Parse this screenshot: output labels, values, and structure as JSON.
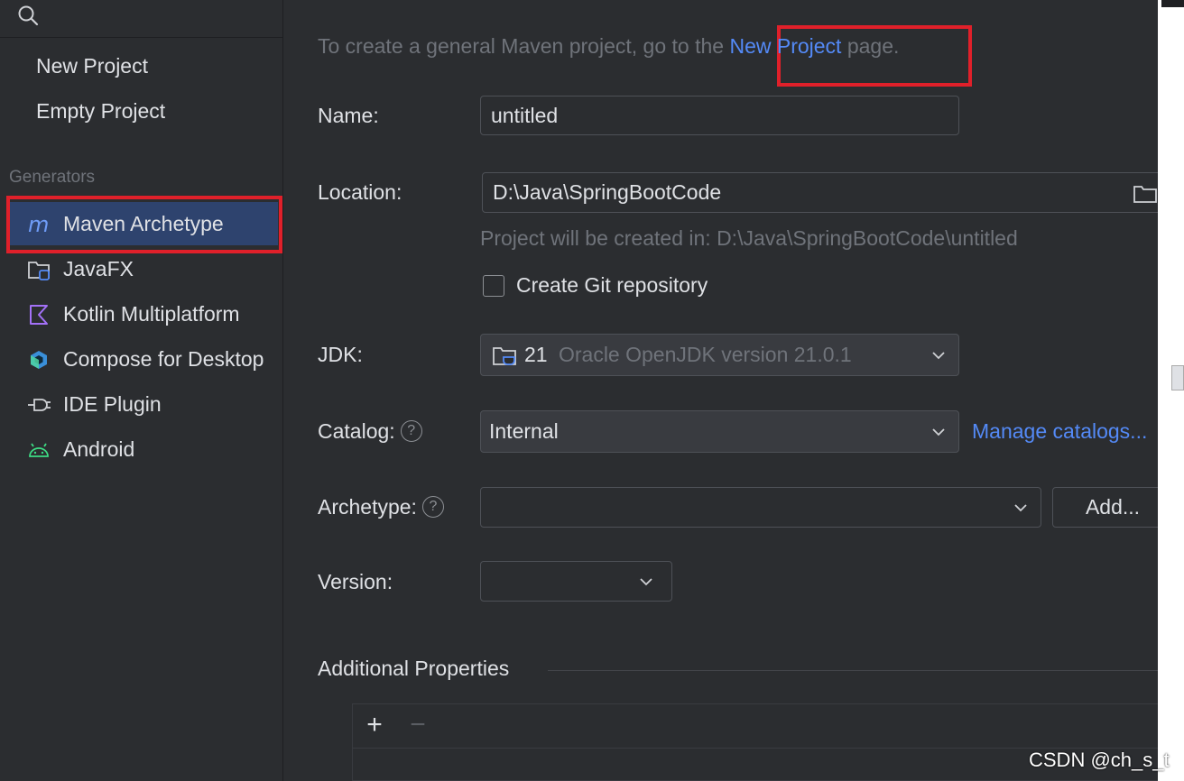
{
  "sidebar": {
    "top_items": [
      {
        "label": "New Project"
      },
      {
        "label": "Empty Project"
      }
    ],
    "section_label": "Generators",
    "generators": [
      {
        "label": "Maven Archetype",
        "icon": "maven-icon",
        "selected": true
      },
      {
        "label": "JavaFX",
        "icon": "javafx-folder-icon"
      },
      {
        "label": "Kotlin Multiplatform",
        "icon": "kotlin-icon"
      },
      {
        "label": "Compose for Desktop",
        "icon": "compose-icon"
      },
      {
        "label": "IDE Plugin",
        "icon": "plugin-icon"
      },
      {
        "label": "Android",
        "icon": "android-icon"
      }
    ]
  },
  "hint": {
    "prefix": "To create a general Maven project, go to the ",
    "link": "New Project",
    "suffix": " page."
  },
  "form": {
    "name_label": "Name:",
    "name_value": "untitled",
    "location_label": "Location:",
    "location_value": "D:\\Java\\SpringBootCode",
    "location_hint": "Project will be created in: D:\\Java\\SpringBootCode\\untitled",
    "git_checkbox_label": "Create Git repository",
    "git_checked": false,
    "jdk_label": "JDK:",
    "jdk_version": "21",
    "jdk_name": "Oracle OpenJDK version 21.0.1",
    "catalog_label": "Catalog:",
    "catalog_value": "Internal",
    "manage_catalogs": "Manage catalogs...",
    "archetype_label": "Archetype:",
    "archetype_value": "",
    "add_button": "Add...",
    "version_label": "Version:",
    "version_value": "",
    "help_glyph": "?"
  },
  "additional_properties": {
    "title": "Additional Properties",
    "add_glyph": "+",
    "remove_glyph": "−"
  },
  "watermark": "CSDN @ch_s_t",
  "colors": {
    "background": "#2b2d30",
    "accent_link": "#548af7",
    "selection": "#2e436e",
    "highlight_box": "#e0202a"
  }
}
